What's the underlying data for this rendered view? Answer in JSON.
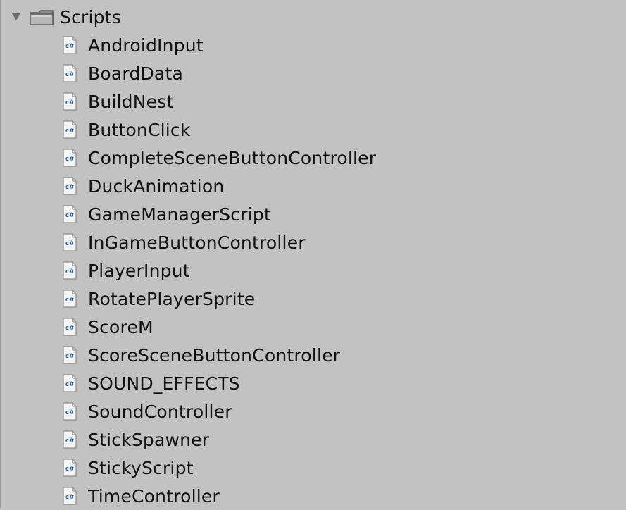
{
  "project": {
    "folder": {
      "label": "Scripts",
      "icon": "folder-icon",
      "expanded": true
    },
    "files": [
      {
        "label": "AndroidInput",
        "icon": "csharp-script-icon"
      },
      {
        "label": "BoardData",
        "icon": "csharp-script-icon"
      },
      {
        "label": "BuildNest",
        "icon": "csharp-script-icon"
      },
      {
        "label": "ButtonClick",
        "icon": "csharp-script-icon"
      },
      {
        "label": "CompleteSceneButtonController",
        "icon": "csharp-script-icon"
      },
      {
        "label": "DuckAnimation",
        "icon": "csharp-script-icon"
      },
      {
        "label": "GameManagerScript",
        "icon": "csharp-script-icon"
      },
      {
        "label": "InGameButtonController",
        "icon": "csharp-script-icon"
      },
      {
        "label": "PlayerInput",
        "icon": "csharp-script-icon"
      },
      {
        "label": "RotatePlayerSprite",
        "icon": "csharp-script-icon"
      },
      {
        "label": "ScoreM",
        "icon": "csharp-script-icon"
      },
      {
        "label": "ScoreSceneButtonController",
        "icon": "csharp-script-icon"
      },
      {
        "label": "SOUND_EFFECTS",
        "icon": "csharp-script-icon"
      },
      {
        "label": "SoundController",
        "icon": "csharp-script-icon"
      },
      {
        "label": "StickSpawner",
        "icon": "csharp-script-icon"
      },
      {
        "label": "StickyScript",
        "icon": "csharp-script-icon"
      },
      {
        "label": "TimeController",
        "icon": "csharp-script-icon"
      }
    ]
  },
  "colors": {
    "background": "#c2c2c2",
    "text": "#111111",
    "csharp_badge": "#2f63b8"
  }
}
